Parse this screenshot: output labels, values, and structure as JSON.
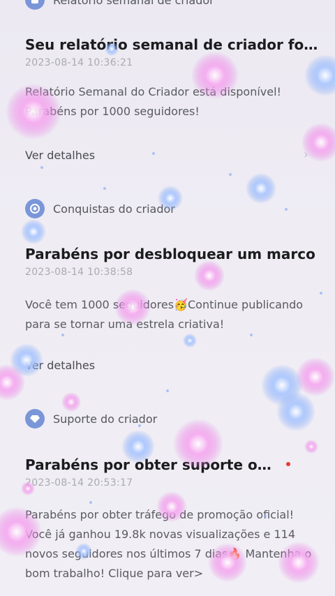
{
  "cards": [
    {
      "sender": "Relatório semanal de criador",
      "title": "Seu relatório semanal de criador foi l...",
      "time": "2023-08-14 10:36:21",
      "body": "Relatório Semanal do Criador está disponível! Parabéns por 1000 seguidores!",
      "link": "Ver detalhes",
      "icon": "report-icon"
    },
    {
      "sender": "Conquistas do criador",
      "title": "Parabéns por desbloquear um marco",
      "time": "2023-08-14 10:38:58",
      "body": "Você tem 1000 seguidores🥳Continue publicando para se tornar uma estrela criativa!",
      "link": "Ver detalhes",
      "icon": "achievement-icon"
    },
    {
      "sender": "Suporte do criador",
      "title": "Parabéns por obter suporte oficial",
      "time": "2023-08-14 20:53:17",
      "body": "Parabéns por obter tráfego de promoção oficial! Você já ganhou 19.8k novas visualizações e 114 novos seguidores nos últimos 7 dias🔥 Mantenha o bom trabalho! Clique para ver>",
      "icon": "diamond-icon"
    }
  ],
  "colors": {
    "icon_bg": "#7a96d8",
    "unread_dot": "#e53935"
  }
}
